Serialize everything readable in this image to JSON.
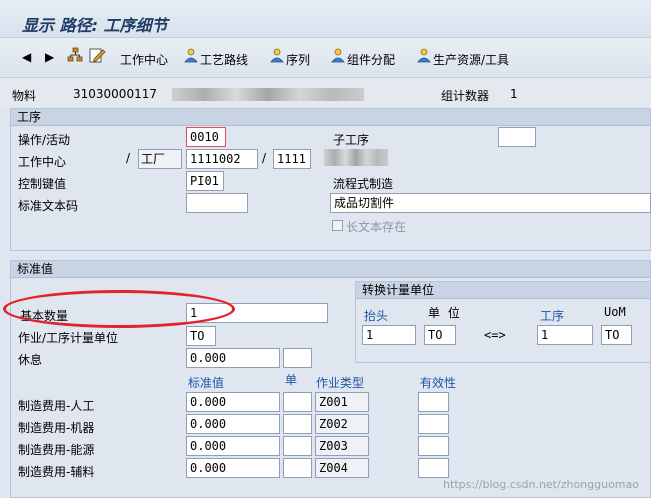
{
  "window": {
    "title": "显示 路径: 工序细节"
  },
  "toolbar": {
    "work_center": "工作中心",
    "routing": "工艺路线",
    "sequence": "序列",
    "component_alloc": "组件分配",
    "prt": "生产资源/工具"
  },
  "header": {
    "material_label": "物料",
    "material_value": "31030000117",
    "group_counter_label": "组计数器",
    "group_counter_value": "1"
  },
  "operation": {
    "section_title": "工序",
    "activity_label": "操作/活动",
    "activity_value": "0010",
    "sub_operation_label": "子工序",
    "work_center_label": "工作中心",
    "plant_label": "工厂",
    "work_center_value": "1111002",
    "plant_value": "1111",
    "control_key_label": "控制键值",
    "control_key_value": "PI01",
    "std_text_label": "标准文本码",
    "flow_mfg_label": "流程式制造",
    "description_value": "成品切割件",
    "long_text_label": "长文本存在"
  },
  "standard": {
    "section_title": "标准值",
    "base_qty_label": "基本数量",
    "base_qty_value": "1",
    "unit_label": "作业/工序计量单位",
    "unit_value": "TO",
    "break_label": "休息",
    "break_value": "0.000",
    "conv_title": "转换计量单位",
    "conv_header_label": "抬头",
    "conv_unit_label": "单 位",
    "conv_operation_label": "工序",
    "conv_uom_label": "UoM",
    "conv_left_value": "1",
    "conv_left_unit": "TO",
    "conv_arrow": "<=>",
    "conv_right_value": "1",
    "conv_right_unit": "TO",
    "col_std_value": "标准值",
    "col_unit": "单",
    "col_activity_type": "作业类型",
    "col_valid": "有效性",
    "rows": [
      {
        "label": "制造费用-人工",
        "value": "0.000",
        "activity_type": "Z001"
      },
      {
        "label": "制造费用-机器",
        "value": "0.000",
        "activity_type": "Z002"
      },
      {
        "label": "制造费用-能源",
        "value": "0.000",
        "activity_type": "Z003"
      },
      {
        "label": "制造费用-辅料",
        "value": "0.000",
        "activity_type": "Z004"
      }
    ]
  },
  "watermark": "https://blog.csdn.net/zhongguomao",
  "colors": {
    "accent": "#1c57a6",
    "highlight": "#e0242a",
    "panel_header": "#c8d4e3"
  }
}
